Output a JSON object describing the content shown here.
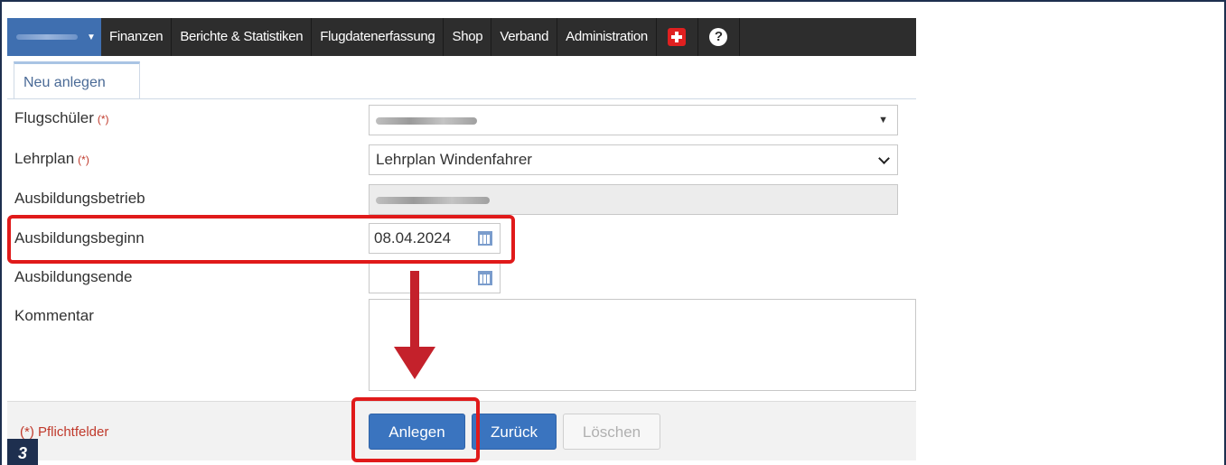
{
  "nav": {
    "items": [
      "Finanzen",
      "Berichte & Statistiken",
      "Flugdatenerfassung",
      "Shop",
      "Verband",
      "Administration"
    ],
    "icons": [
      "plus-icon",
      "help-icon"
    ],
    "help_glyph": "?"
  },
  "tab": {
    "label": "Neu anlegen"
  },
  "form": {
    "required_marker": "(*)",
    "flugschueler_label": "Flugschüler",
    "lehrplan_label": "Lehrplan",
    "lehrplan_value": "Lehrplan Windenfahrer",
    "ausbildungsbetrieb_label": "Ausbildungsbetrieb",
    "ausbildungsbeginn_label": "Ausbildungsbeginn",
    "ausbildungsbeginn_value": "08.04.2024",
    "ausbildungsende_label": "Ausbildungsende",
    "ausbildungsende_value": "",
    "kommentar_label": "Kommentar"
  },
  "footer": {
    "required_note": "(*) Pflichtfelder",
    "anlegen_label": "Anlegen",
    "zurueck_label": "Zurück",
    "loeschen_label": "Löschen"
  },
  "annotation": {
    "step_number": "3",
    "highlight_color": "#e01a1a",
    "arrow_color": "#c4212b"
  },
  "colors": {
    "navbar": "#2d2d2d",
    "brand": "#3f6fb0",
    "primary_button": "#3a74bf",
    "frame": "#1e2f4f"
  }
}
